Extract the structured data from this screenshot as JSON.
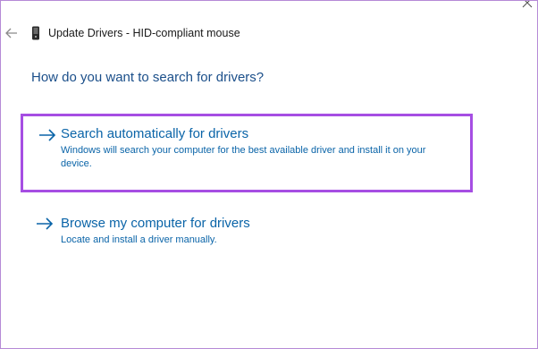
{
  "window": {
    "title": "Update Drivers - HID-compliant mouse",
    "back_icon": "back-arrow-icon",
    "device_icon": "mouse-device-icon",
    "close_icon": "close-icon"
  },
  "main": {
    "heading": "How do you want to search for drivers?",
    "options": [
      {
        "title": "Search automatically for drivers",
        "description": "Windows will search your computer for the best available driver and install it on your device.",
        "icon": "right-arrow-icon",
        "highlighted": true
      },
      {
        "title": "Browse my computer for drivers",
        "description": "Locate and install a driver manually.",
        "icon": "right-arrow-icon",
        "highlighted": false
      }
    ]
  },
  "colors": {
    "heading": "#1b4f8a",
    "link": "#0a64a8",
    "highlight_border": "#a64ee3",
    "window_border": "#b58ad6"
  }
}
